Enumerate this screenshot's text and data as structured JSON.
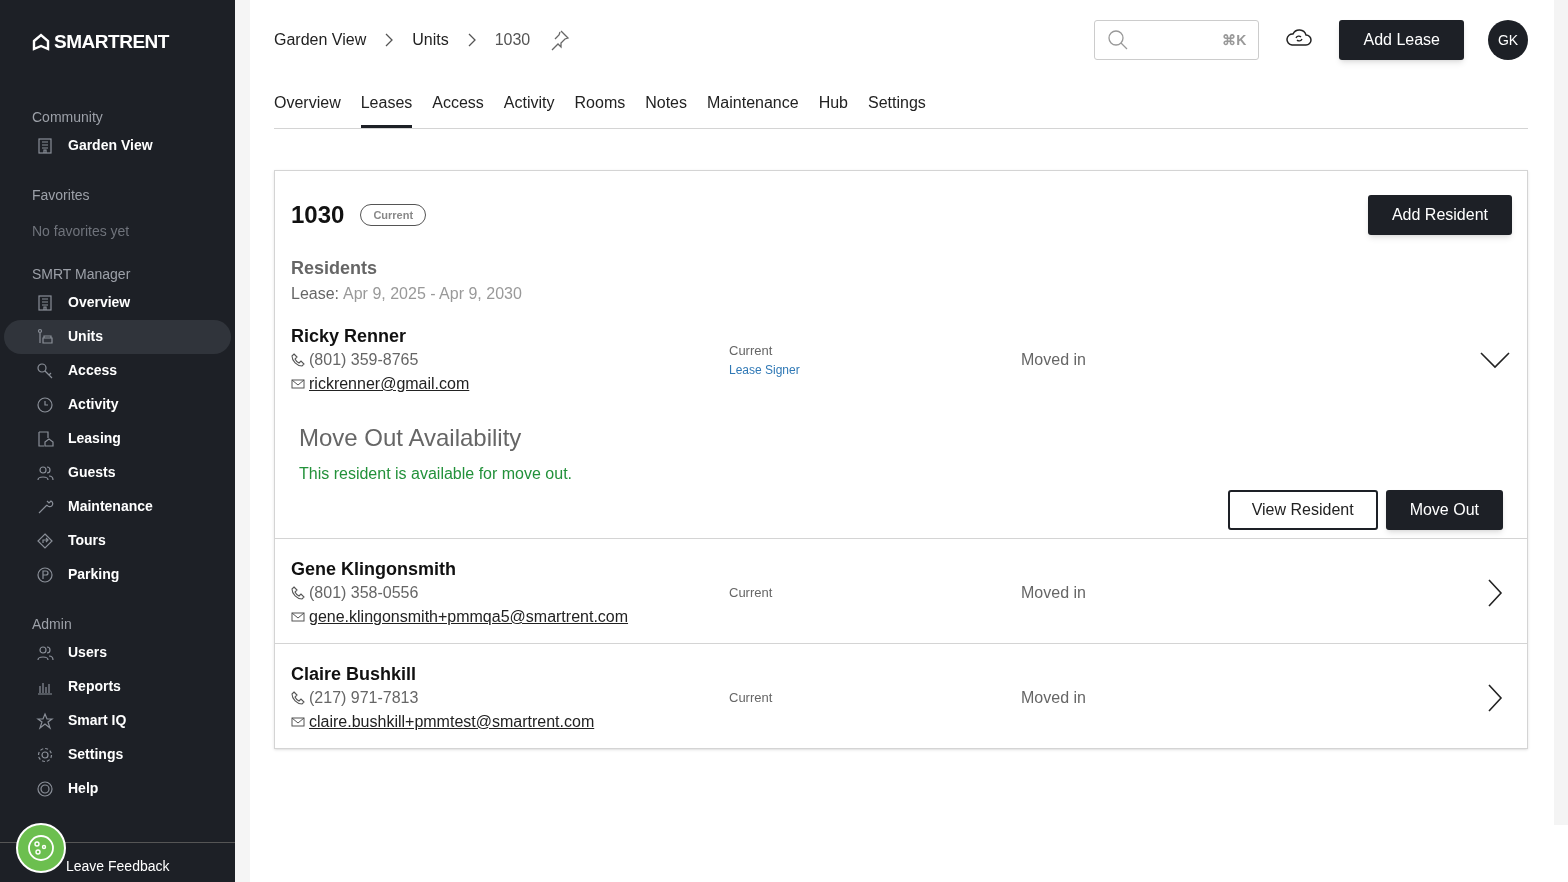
{
  "logo": "SMARTRENT",
  "sidebar": {
    "sections": [
      {
        "title": "Community",
        "items": [
          {
            "label": "Garden View",
            "selected": false
          }
        ]
      },
      {
        "title": "Favorites",
        "empty_text": "No favorites yet"
      },
      {
        "title": "SMRT Manager",
        "items": [
          {
            "label": "Overview",
            "selected": false
          },
          {
            "label": "Units",
            "selected": true
          },
          {
            "label": "Access",
            "selected": false
          },
          {
            "label": "Activity",
            "selected": false
          },
          {
            "label": "Leasing",
            "selected": false
          },
          {
            "label": "Guests",
            "selected": false
          },
          {
            "label": "Maintenance",
            "selected": false
          },
          {
            "label": "Tours",
            "selected": false
          },
          {
            "label": "Parking",
            "selected": false
          }
        ]
      },
      {
        "title": "Admin",
        "items": [
          {
            "label": "Users",
            "selected": false
          },
          {
            "label": "Reports",
            "selected": false
          },
          {
            "label": "Smart IQ",
            "selected": false
          },
          {
            "label": "Settings",
            "selected": false
          },
          {
            "label": "Help",
            "selected": false
          }
        ]
      }
    ],
    "feedback": "Leave Feedback"
  },
  "breadcrumb": [
    "Garden View",
    "Units",
    "1030"
  ],
  "search": {
    "shortcut": "⌘K"
  },
  "add_lease_button": "Add Lease",
  "avatar": "GK",
  "tabs": [
    {
      "label": "Overview",
      "selected": false
    },
    {
      "label": "Leases",
      "selected": true
    },
    {
      "label": "Access",
      "selected": false
    },
    {
      "label": "Activity",
      "selected": false
    },
    {
      "label": "Rooms",
      "selected": false
    },
    {
      "label": "Notes",
      "selected": false
    },
    {
      "label": "Maintenance",
      "selected": false
    },
    {
      "label": "Hub",
      "selected": false
    },
    {
      "label": "Settings",
      "selected": false
    }
  ],
  "lease": {
    "unit": "1030",
    "badge": "Current",
    "add_resident_button": "Add Resident",
    "residents_heading": "Residents",
    "lease_label": "Lease:",
    "lease_dates": "Apr 9, 2025 - Apr 9, 2030",
    "residents": [
      {
        "name": "Ricky Renner",
        "phone": "(801) 359-8765",
        "email": "rickrenner@gmail.com",
        "status": "Current",
        "role": "Lease Signer",
        "move_status": "Moved in",
        "expanded": true,
        "move_out": {
          "title": "Move Out Availability",
          "message": "This resident is available for move out.",
          "view_button": "View Resident",
          "move_out_button": "Move Out"
        }
      },
      {
        "name": "Gene Klingonsmith",
        "phone": "(801) 358-0556",
        "email": "gene.klingonsmith+pmmqa5@smartrent.com",
        "status": "Current",
        "move_status": "Moved in",
        "expanded": false
      },
      {
        "name": "Claire Bushkill",
        "phone": "(217) 971-7813",
        "email": "claire.bushkill+pmmtest@smartrent.com",
        "status": "Current",
        "move_status": "Moved in",
        "expanded": false
      }
    ]
  }
}
